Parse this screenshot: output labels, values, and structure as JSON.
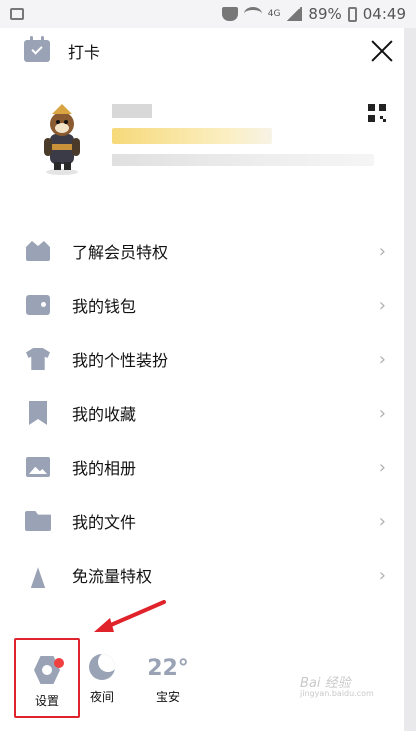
{
  "statusbar": {
    "battery": "89%",
    "time": "04:49",
    "network": "4G"
  },
  "header": {
    "title": "打卡"
  },
  "menu": {
    "items": [
      {
        "label": "了解会员特权",
        "icon": "crown-icon"
      },
      {
        "label": "我的钱包",
        "icon": "wallet-icon"
      },
      {
        "label": "我的个性装扮",
        "icon": "shirt-icon"
      },
      {
        "label": "我的收藏",
        "icon": "bookmark-icon"
      },
      {
        "label": "我的相册",
        "icon": "photo-icon"
      },
      {
        "label": "我的文件",
        "icon": "folder-icon"
      },
      {
        "label": "免流量特权",
        "icon": "antenna-icon"
      }
    ],
    "chevron": "›"
  },
  "bottom": {
    "settings_label": "设置",
    "night_label": "夜间",
    "weather_temp": "22°",
    "weather_city": "宝安"
  },
  "watermark": {
    "brand": "Bai 经验",
    "url": "jingyan.baidu.com"
  },
  "colors": {
    "icon_gray": "#9aa3b5",
    "badge_red": "#f04040",
    "highlight_red": "#e0222a"
  }
}
